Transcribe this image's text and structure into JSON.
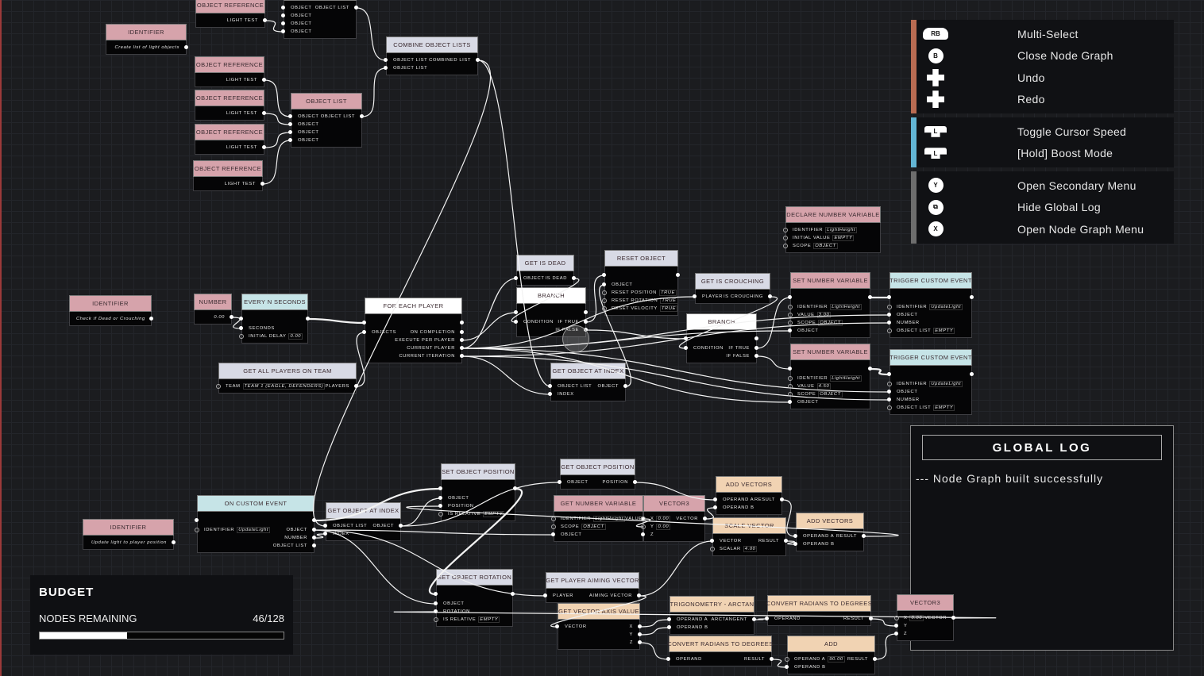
{
  "colors": {
    "pink": "#d6a3ab",
    "grey": "#d8dae5",
    "white": "#ffffff",
    "cyan": "#c6e4e7",
    "peach": "#f1d3b3",
    "group_edit": "#b86b52",
    "group_cursor": "#62b5d4",
    "group_menu": "#6d6d6d"
  },
  "nodes": [
    {
      "title": "OBJECT REFERENCE",
      "type": "pink",
      "rows": [
        [
          "",
          "",
          "LIGHT TEST"
        ]
      ]
    },
    {
      "title": "",
      "type": "grey",
      "rows": [
        [
          "OBJECT",
          "",
          "OBJECT LIST"
        ],
        [
          "OBJECT",
          "",
          ""
        ],
        [
          "OBJECT",
          "",
          ""
        ],
        [
          "OBJECT",
          "",
          ""
        ]
      ]
    },
    {
      "title": "IDENTIFIER",
      "type": "pink",
      "rows": [
        [
          "",
          "",
          "Create list of light objects"
        ]
      ]
    },
    {
      "title": "OBJECT REFERENCE",
      "type": "pink",
      "rows": [
        [
          "",
          "",
          "LIGHT TEST"
        ]
      ]
    },
    {
      "title": "OBJECT REFERENCE",
      "type": "pink",
      "rows": [
        [
          "",
          "",
          "LIGHT TEST"
        ]
      ]
    },
    {
      "title": "OBJECT REFERENCE",
      "type": "pink",
      "rows": [
        [
          "",
          "",
          "LIGHT TEST"
        ]
      ]
    },
    {
      "title": "OBJECT REFERENCE",
      "type": "pink",
      "rows": [
        [
          "",
          "",
          "LIGHT TEST"
        ]
      ]
    },
    {
      "title": "OBJECT LIST",
      "type": "pink",
      "rows": [
        [
          "OBJECT",
          "",
          "OBJECT LIST"
        ],
        [
          "OBJECT",
          "",
          ""
        ],
        [
          "OBJECT",
          "",
          ""
        ],
        [
          "OBJECT",
          "",
          ""
        ]
      ]
    },
    {
      "title": "COMBINE OBJECT LISTS",
      "type": "grey",
      "rows": [
        [
          "OBJECT LIST",
          "",
          "COMBINED LIST"
        ],
        [
          "OBJECT LIST",
          "",
          ""
        ]
      ]
    },
    {
      "title": "IDENTIFIER",
      "type": "pink",
      "rows": [
        [
          "",
          "",
          "Check if Dead or Crouching"
        ]
      ]
    },
    {
      "title": "NUMBER",
      "type": "pink",
      "rows": [
        [
          "",
          "",
          "0.00"
        ]
      ]
    },
    {
      "title": "EVERY N SECONDS",
      "type": "cyan",
      "exec": true,
      "rows": [
        [
          "SECONDS",
          "",
          ""
        ],
        [
          "INITIAL DELAY",
          "0.00",
          ""
        ]
      ]
    },
    {
      "title": "FOR EACH PLAYER",
      "type": "white",
      "exec": true,
      "rows": [
        [
          "OBJECTS",
          "",
          "ON COMPLETION"
        ],
        [
          "",
          "",
          "EXECUTE PER PLAYER"
        ],
        [
          "",
          "",
          "CURRENT PLAYER"
        ],
        [
          "",
          "",
          "CURRENT ITERATION"
        ]
      ]
    },
    {
      "title": "GET ALL PLAYERS ON TEAM",
      "type": "grey",
      "rows": [
        [
          "TEAM",
          "TEAM 1 (EAGLE, DEFENDERS)",
          "PLAYERS"
        ]
      ]
    },
    {
      "title": "GET IS DEAD",
      "type": "grey",
      "rows": [
        [
          "OBJECT",
          "",
          "IS DEAD"
        ]
      ]
    },
    {
      "title": "BRANCH",
      "type": "white",
      "exec": true,
      "rows": [
        [
          "CONDITION",
          "",
          "IF TRUE"
        ],
        [
          "",
          "",
          "IF FALSE"
        ]
      ]
    },
    {
      "title": "RESET OBJECT",
      "type": "grey",
      "exec": true,
      "rows": [
        [
          "OBJECT",
          "",
          ""
        ],
        [
          "RESET POSITION",
          "TRUE",
          ""
        ],
        [
          "RESET ROTATION",
          "TRUE",
          ""
        ],
        [
          "RESET VELOCITY",
          "TRUE",
          ""
        ]
      ]
    },
    {
      "title": "GET IS CROUCHING",
      "type": "grey",
      "rows": [
        [
          "PLAYER",
          "",
          "IS CROUCHING"
        ]
      ]
    },
    {
      "title": "BRANCH",
      "type": "white",
      "exec": true,
      "rows": [
        [
          "CONDITION",
          "",
          "IF TRUE"
        ],
        [
          "",
          "",
          "IF FALSE"
        ]
      ]
    },
    {
      "title": "GET OBJECT AT INDEX",
      "type": "grey",
      "rows": [
        [
          "OBJECT LIST",
          "",
          "OBJECT"
        ],
        [
          "INDEX",
          "",
          ""
        ]
      ]
    },
    {
      "title": "DECLARE NUMBER VARIABLE",
      "type": "pink",
      "rows": [
        [
          "IDENTIFIER",
          "LightHeight",
          ""
        ],
        [
          "INITIAL VALUE",
          "EMPTY",
          ""
        ],
        [
          "SCOPE",
          "OBJECT",
          ""
        ]
      ]
    },
    {
      "title": "SET NUMBER VARIABLE",
      "type": "pink",
      "exec": true,
      "rows": [
        [
          "IDENTIFIER",
          "LightHeight",
          ""
        ],
        [
          "VALUE",
          "3.00",
          ""
        ],
        [
          "SCOPE",
          "OBJECT",
          ""
        ],
        [
          "OBJECT",
          "",
          ""
        ]
      ]
    },
    {
      "title": "TRIGGER CUSTOM EVENT",
      "type": "cyan",
      "exec": true,
      "rows": [
        [
          "IDENTIFIER",
          "UpdateLight",
          ""
        ],
        [
          "OBJECT",
          "",
          ""
        ],
        [
          "NUMBER",
          "",
          ""
        ],
        [
          "OBJECT LIST",
          "EMPTY",
          ""
        ]
      ]
    },
    {
      "title": "SET NUMBER VARIABLE",
      "type": "pink",
      "exec": true,
      "rows": [
        [
          "IDENTIFIER",
          "LightHeight",
          ""
        ],
        [
          "VALUE",
          "4.50",
          ""
        ],
        [
          "SCOPE",
          "OBJECT",
          ""
        ],
        [
          "OBJECT",
          "",
          ""
        ]
      ]
    },
    {
      "title": "TRIGGER CUSTOM EVENT",
      "type": "cyan",
      "exec": true,
      "rows": [
        [
          "IDENTIFIER",
          "UpdateLight",
          ""
        ],
        [
          "OBJECT",
          "",
          ""
        ],
        [
          "NUMBER",
          "",
          ""
        ],
        [
          "OBJECT LIST",
          "EMPTY",
          ""
        ]
      ]
    },
    {
      "title": "IDENTIFIER",
      "type": "pink",
      "rows": [
        [
          "",
          "",
          "Update light to player position"
        ]
      ]
    },
    {
      "title": "ON CUSTOM EVENT",
      "type": "cyan",
      "exec": true,
      "rows": [
        [
          "IDENTIFIER",
          "UpdateLight",
          "OBJECT"
        ],
        [
          "",
          "",
          "NUMBER"
        ],
        [
          "",
          "",
          "OBJECT LIST"
        ]
      ]
    },
    {
      "title": "GET OBJECT AT INDEX",
      "type": "grey",
      "rows": [
        [
          "OBJECT LIST",
          "",
          "OBJECT"
        ],
        [
          "INDEX",
          "",
          ""
        ]
      ]
    },
    {
      "title": "SET OBJECT POSITION",
      "type": "grey",
      "exec": true,
      "rows": [
        [
          "OBJECT",
          "",
          ""
        ],
        [
          "POSITION",
          "",
          ""
        ],
        [
          "IS RELATIVE",
          "EMPTY",
          ""
        ]
      ]
    },
    {
      "title": "GET OBJECT POSITION",
      "type": "grey",
      "rows": [
        [
          "OBJECT",
          "",
          "POSITION"
        ]
      ]
    },
    {
      "title": "GET NUMBER VARIABLE",
      "type": "pink",
      "rows": [
        [
          "IDENTIFIER",
          "LightHeight",
          "VALUE"
        ],
        [
          "SCOPE",
          "OBJECT",
          ""
        ],
        [
          "OBJECT",
          "",
          ""
        ]
      ]
    },
    {
      "title": "VECTOR3",
      "type": "pink",
      "rows": [
        [
          "X",
          "0.00",
          "VECTOR"
        ],
        [
          "Y",
          "0.00",
          ""
        ],
        [
          "Z",
          "",
          ""
        ]
      ]
    },
    {
      "title": "ADD VECTORS",
      "type": "peach",
      "rows": [
        [
          "OPERAND A",
          "",
          "RESULT"
        ],
        [
          "OPERAND B",
          "",
          ""
        ]
      ]
    },
    {
      "title": "SCALE VECTOR",
      "type": "peach",
      "rows": [
        [
          "VECTOR",
          "",
          "RESULT"
        ],
        [
          "SCALAR",
          "4.00",
          ""
        ]
      ]
    },
    {
      "title": "ADD VECTORS",
      "type": "peach",
      "rows": [
        [
          "OPERAND A",
          "",
          "RESULT"
        ],
        [
          "OPERAND B",
          "",
          ""
        ]
      ]
    },
    {
      "title": "SET OBJECT ROTATION",
      "type": "grey",
      "exec": true,
      "rows": [
        [
          "OBJECT",
          "",
          ""
        ],
        [
          "ROTATION",
          "",
          ""
        ],
        [
          "IS RELATIVE",
          "EMPTY",
          ""
        ]
      ]
    },
    {
      "title": "GET PLAYER AIMING VECTOR",
      "type": "grey",
      "rows": [
        [
          "PLAYER",
          "",
          "AIMING VECTOR"
        ]
      ]
    },
    {
      "title": "GET VECTOR AXIS VALUE",
      "type": "peach",
      "rows": [
        [
          "VECTOR",
          "",
          "X"
        ],
        [
          "",
          "",
          "Y"
        ],
        [
          "",
          "",
          "Z"
        ]
      ]
    },
    {
      "title": "TRIGONOMETRY - ARCTAN",
      "type": "peach",
      "rows": [
        [
          "OPERAND A",
          "",
          "ARCTANGENT"
        ],
        [
          "OPERAND B",
          "",
          ""
        ]
      ]
    },
    {
      "title": "CONVERT RADIANS TO DEGREES",
      "type": "peach",
      "rows": [
        [
          "OPERAND",
          "",
          "RESULT"
        ]
      ]
    },
    {
      "title": "CONVERT RADIANS TO DEGREES",
      "type": "peach",
      "rows": [
        [
          "OPERAND",
          "",
          "RESULT"
        ]
      ]
    },
    {
      "title": "ADD",
      "type": "peach",
      "rows": [
        [
          "OPERAND A",
          "90.00",
          "RESULT"
        ],
        [
          "OPERAND B",
          "",
          ""
        ]
      ]
    },
    {
      "title": "VECTOR3",
      "type": "pink",
      "rows": [
        [
          "X",
          "0.00",
          "VECTOR"
        ],
        [
          "Y",
          "",
          ""
        ],
        [
          "Z",
          "",
          ""
        ]
      ]
    }
  ],
  "controls": [
    {
      "group": "group_edit",
      "items": [
        {
          "icon": "rb-button-icon",
          "glyph": "RB",
          "label": "Multi-Select"
        },
        {
          "icon": "b-button-icon",
          "glyph": "B",
          "label": "Close Node Graph"
        },
        {
          "icon": "dpad-down-icon",
          "glyph": "",
          "label": "Undo"
        },
        {
          "icon": "dpad-up-icon",
          "glyph": "",
          "label": "Redo"
        }
      ]
    },
    {
      "group": "group_cursor",
      "items": [
        {
          "icon": "left-stick-click-icon",
          "glyph": "L",
          "label": "Toggle Cursor Speed"
        },
        {
          "icon": "left-stick-click-icon",
          "glyph": "L",
          "label": "[Hold] Boost Mode"
        }
      ]
    },
    {
      "group": "group_menu",
      "items": [
        {
          "icon": "y-button-icon",
          "glyph": "Y",
          "label": "Open Secondary Menu"
        },
        {
          "icon": "view-button-icon",
          "glyph": "⧉",
          "label": "Hide Global Log"
        },
        {
          "icon": "x-button-icon",
          "glyph": "X",
          "label": "Open Node Graph Menu"
        }
      ]
    }
  ],
  "global_log": {
    "title": "GLOBAL LOG",
    "messages": [
      "--- Node Graph built successfully"
    ]
  },
  "budget": {
    "title": "BUDGET",
    "label": "NODES REMAINING",
    "value": "46/128",
    "used": 46,
    "total": 128
  }
}
